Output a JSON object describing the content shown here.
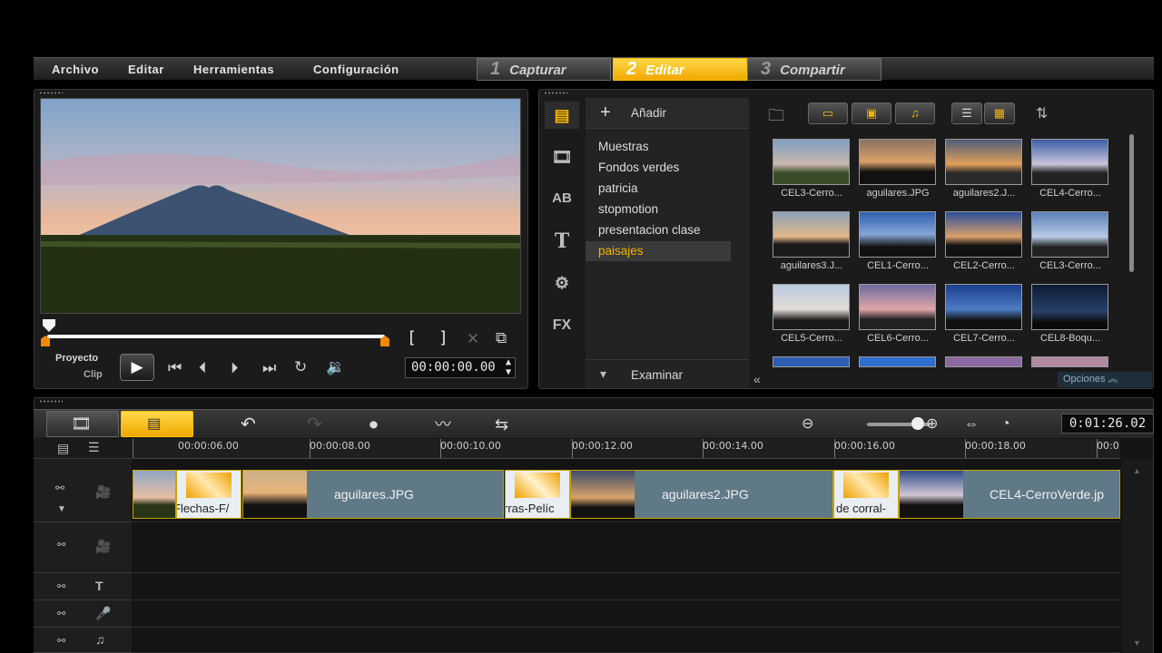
{
  "menu": {
    "items": [
      "Archivo",
      "Editar",
      "Herramientas",
      "Configuración"
    ]
  },
  "steps": [
    {
      "num": "1",
      "label": "Capturar"
    },
    {
      "num": "2",
      "label": "Editar"
    },
    {
      "num": "3",
      "label": "Compartir"
    }
  ],
  "player": {
    "mode_proyecto": "Proyecto",
    "mode_clip": "Clip",
    "bracket_in": "[",
    "bracket_out": "]",
    "timecode": "00:00:00.00"
  },
  "library": {
    "add_label": "Añadir",
    "folders": [
      "Muestras",
      "Fondos verdes",
      "patricia",
      "stopmotion",
      "presentacion clase",
      "paisajes"
    ],
    "selected_folder": "paisajes",
    "browse_label": "Examinar",
    "fx_label": "FX",
    "ab_label": "AB",
    "options_label": "Opciones",
    "thumbnails": [
      "CEL3-Cerro...",
      "aguilares.JPG",
      "aguilares2.J...",
      "CEL4-Cerro...",
      "aguilares3.J...",
      "CEL1-Cerro...",
      "CEL2-Cerro...",
      "CEL3-Cerro...",
      "CEL5-Cerro...",
      "CEL6-Cerro...",
      "CEL7-Cerro...",
      "CEL8-Boqu..."
    ]
  },
  "timeline": {
    "timecode": "0:01:26.02",
    "ruler": [
      "00:00:06.00",
      "00:00:08.00",
      "00:00:10.00",
      "00:00:12.00",
      "00:00:14.00",
      "00:00:16.00",
      "00:00:18.00",
      "00:0"
    ],
    "clips": {
      "c1": "Flechas-F/",
      "c2": "aguilares.JPG",
      "c3": "rras-Pelíc",
      "c4": "aguilares2.JPG",
      "c5": "de corral-",
      "c6": "CEL4-CerroVerde.jp"
    }
  },
  "colors": {
    "accent": "#f5b400",
    "clip_bg": "#5f7986"
  }
}
